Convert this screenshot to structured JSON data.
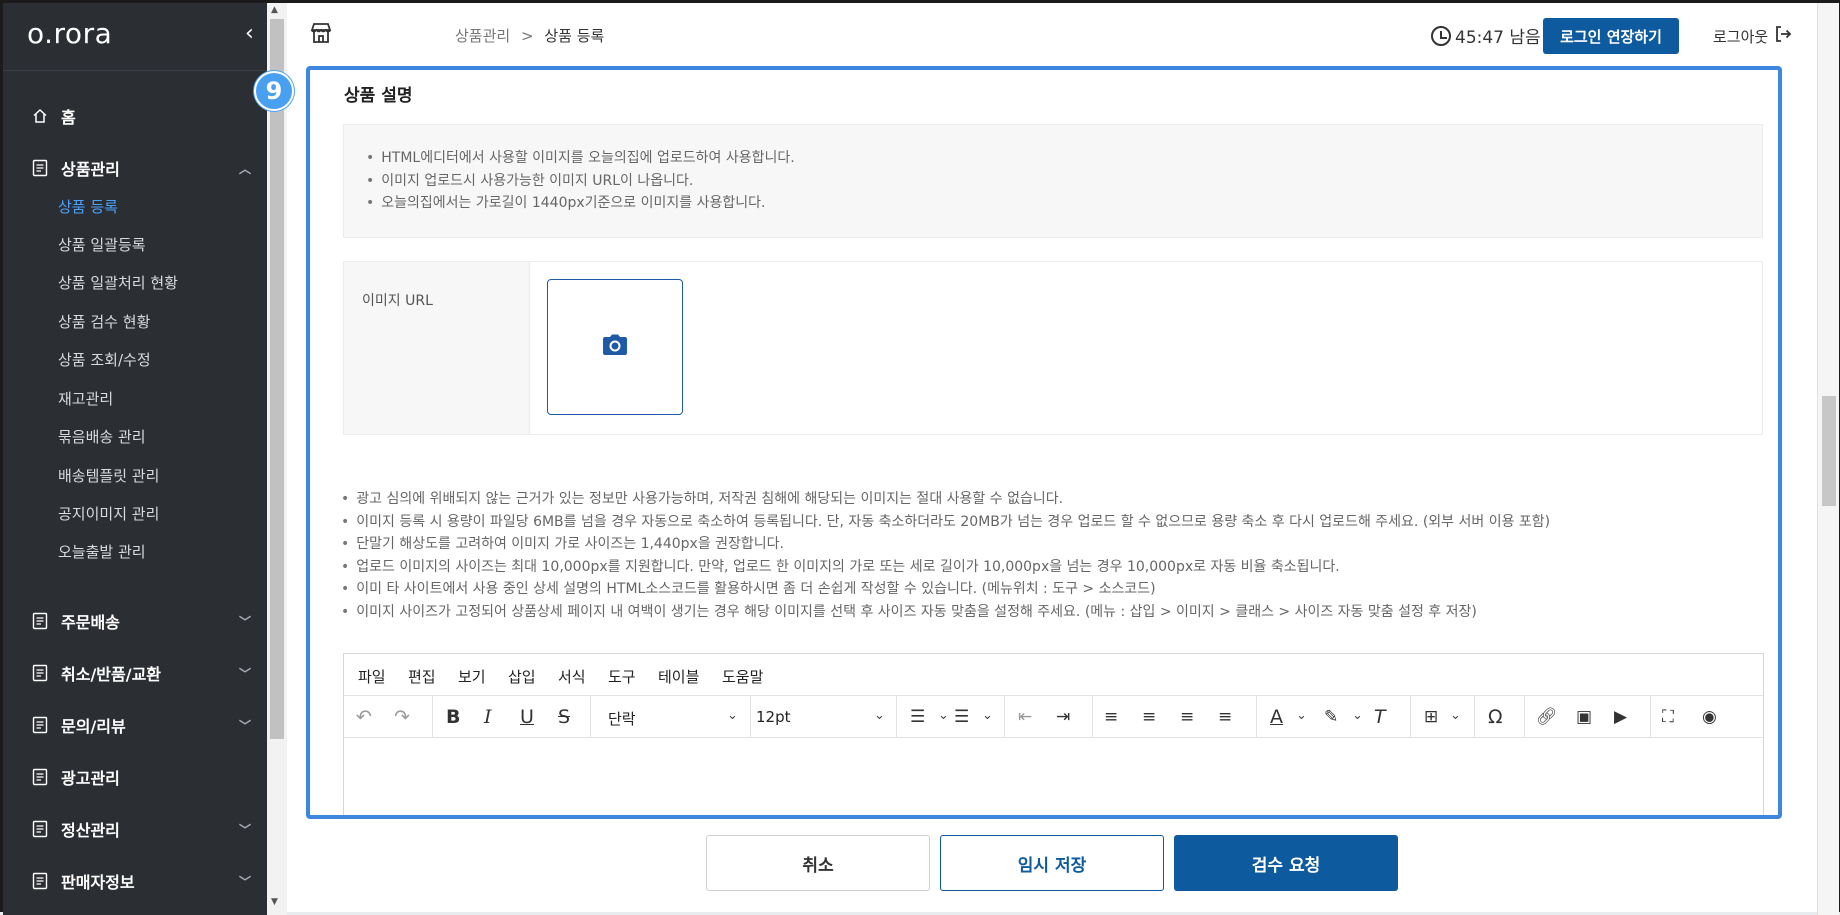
{
  "sidebar": {
    "logo": "o.rora",
    "collapse_icon": "‹",
    "menu": [
      {
        "label": "홈",
        "icon": "home-icon"
      },
      {
        "label": "상품관리",
        "icon": "document-icon",
        "expanded": true
      },
      {
        "label": "주문배송",
        "icon": "document-icon"
      },
      {
        "label": "취소/반품/교환",
        "icon": "document-icon"
      },
      {
        "label": "문의/리뷰",
        "icon": "document-icon"
      },
      {
        "label": "광고관리",
        "icon": "document-icon"
      },
      {
        "label": "정산관리",
        "icon": "document-icon"
      },
      {
        "label": "판매자정보",
        "icon": "document-icon"
      }
    ],
    "submenu": [
      {
        "label": "상품 등록",
        "active": true
      },
      {
        "label": "상품 일괄등록"
      },
      {
        "label": "상품 일괄처리 현황"
      },
      {
        "label": "상품 검수 현황"
      },
      {
        "label": "상품 조회/수정"
      },
      {
        "label": "재고관리"
      },
      {
        "label": "묶음배송 관리"
      },
      {
        "label": "배송템플릿 관리"
      },
      {
        "label": "공지이미지 관리"
      },
      {
        "label": "오늘출발 관리"
      }
    ]
  },
  "topbar": {
    "breadcrumb_parent": "상품관리",
    "breadcrumb_sep": ">",
    "breadcrumb_current": "상품 등록",
    "timer": "45:47 남음",
    "extend_label": "로그인 연장하기",
    "logout_label": "로그아웃"
  },
  "step_badge": "9",
  "section": {
    "title": "상품 설명",
    "info": [
      "HTML에디터에서 사용할 이미지를 오늘의집에 업로드하여 사용합니다.",
      "이미지 업로드시 사용가능한 이미지 URL이 나옵니다.",
      "오늘의집에서는 가로길이 1440px기준으로 이미지를 사용합니다."
    ],
    "image_url_label": "이미지 URL",
    "notes": [
      "광고 심의에 위배되지 않는 근거가 있는 정보만 사용가능하며, 저작권 침해에 해당되는 이미지는 절대 사용할 수 없습니다.",
      "이미지 등록 시 용량이 파일당 6MB를 넘을 경우 자동으로 축소하여 등록됩니다. 단, 자동 축소하더라도 20MB가 넘는 경우 업로드 할 수 없으므로 용량 축소 후 다시 업로드해 주세요. (외부 서버 이용 포함)",
      "단말기 해상도를 고려하여 이미지 가로 사이즈는 1,440px을 권장합니다.",
      "업로드 이미지의 사이즈는 최대 10,000px를 지원합니다. 만약, 업로드 한 이미지의 가로 또는 세로 길이가 10,000px을 넘는 경우 10,000px로 자동 비율 축소됩니다.",
      "이미 타 사이트에서 사용 중인 상세 설명의 HTML소스코드를 활용하시면 좀 더 손쉽게 작성할 수 있습니다. (메뉴위치 : 도구 > 소스코드)",
      "이미지 사이즈가 고정되어 상품상세 페이지 내 여백이 생기는 경우 해당 이미지를 선택 후 사이즈 자동 맞춤을 설정해 주세요. (메뉴 : 삽입 > 이미지 > 클래스 > 사이즈 자동 맞춤 설정 후 저장)"
    ]
  },
  "editor": {
    "menubar": [
      "파일",
      "편집",
      "보기",
      "삽입",
      "서식",
      "도구",
      "테이블",
      "도움말"
    ],
    "block_format": "단락",
    "font_size": "12pt"
  },
  "footer": {
    "cancel_label": "취소",
    "draft_label": "임시 저장",
    "submit_label": "검수 요청"
  },
  "colors": {
    "primary": "#0d5a9e",
    "highlight": "#3d87e0",
    "sidebar_bg": "#2b2e33",
    "active_link": "#4aa3ff"
  }
}
